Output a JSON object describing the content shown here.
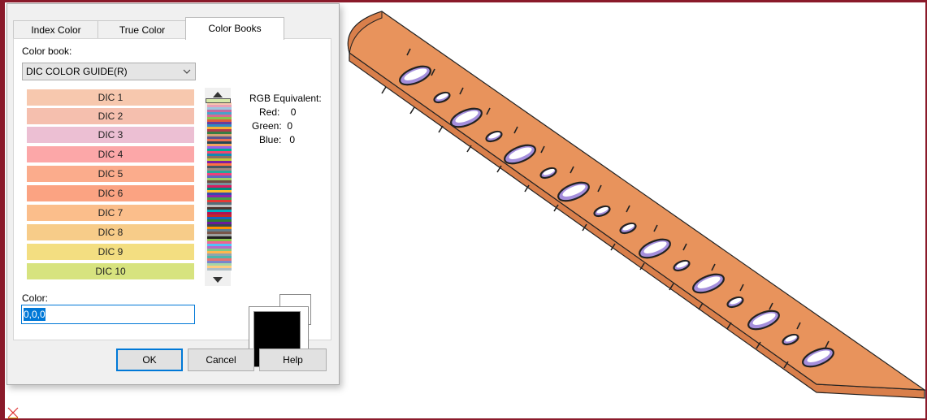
{
  "dialog": {
    "tabs": [
      "Index Color",
      "True Color",
      "Color Books"
    ],
    "active_tab": "Color Books",
    "color_book_label": "Color book:",
    "color_book_value": "DIC COLOR GUIDE(R)",
    "swatches": [
      {
        "label": "DIC 1",
        "color": "#f7c8ae"
      },
      {
        "label": "DIC 2",
        "color": "#f5bfae"
      },
      {
        "label": "DIC 3",
        "color": "#ecbfd3"
      },
      {
        "label": "DIC 4",
        "color": "#fca7a8"
      },
      {
        "label": "DIC 5",
        "color": "#fbac8c"
      },
      {
        "label": "DIC 6",
        "color": "#fba382"
      },
      {
        "label": "DIC 7",
        "color": "#fbbe8b"
      },
      {
        "label": "DIC 8",
        "color": "#f7cc89"
      },
      {
        "label": "DIC 9",
        "color": "#f3de81"
      },
      {
        "label": "DIC 10",
        "color": "#d7e37f"
      }
    ],
    "rgb": {
      "heading": "RGB Equivalent:",
      "red_label": "Red:",
      "red": "0",
      "green_label": "Green:",
      "green": "0",
      "blue_label": "Blue:",
      "blue": "0"
    },
    "color_label": "Color:",
    "color_value": "0,0,0",
    "buttons": {
      "ok": "OK",
      "cancel": "Cancel",
      "help": "Help"
    }
  },
  "viewport": {
    "part_color": "#e8935c",
    "hole_color": "#a58fdc"
  }
}
